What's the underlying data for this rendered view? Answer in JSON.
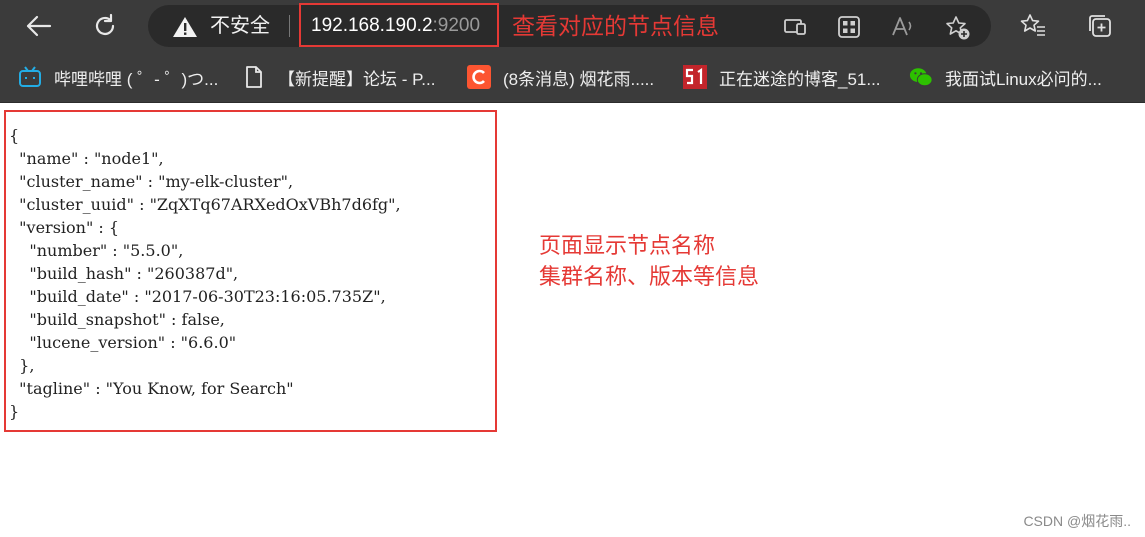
{
  "address_bar": {
    "security_label": "不安全",
    "host": "192.168.190.2",
    "port": ":9200",
    "annotation": "查看对应的节点信息"
  },
  "bookmarks": [
    {
      "icon": "bilibili-icon",
      "label": "哔哩哔哩 ( ゜- ゜)つ..."
    },
    {
      "icon": "document-icon",
      "label": "【新提醒】论坛 - P..."
    },
    {
      "icon": "csdn-icon",
      "label": "(8条消息) 烟花雨....."
    },
    {
      "icon": "51cto-icon",
      "label": "正在迷途的博客_51..."
    },
    {
      "icon": "wechat-icon",
      "label": "我面试Linux必问的..."
    }
  ],
  "json_lines": [
    "{",
    "  \"name\" : \"node1\",",
    "  \"cluster_name\" : \"my-elk-cluster\",",
    "  \"cluster_uuid\" : \"ZqXTq67ARXedOxVBh7d6fg\",",
    "  \"version\" : {",
    "    \"number\" : \"5.5.0\",",
    "    \"build_hash\" : \"260387d\",",
    "    \"build_date\" : \"2017-06-30T23:16:05.735Z\",",
    "    \"build_snapshot\" : false,",
    "    \"lucene_version\" : \"6.6.0\"",
    "  },",
    "  \"tagline\" : \"You Know, for Search\"",
    "}"
  ],
  "annotation": {
    "line1": "页面显示节点名称",
    "line2": "集群名称、版本等信息"
  },
  "watermark": "CSDN @烟花雨..",
  "colors": {
    "toolbar": "#3b3b3b",
    "annotation_red": "#e53935"
  }
}
